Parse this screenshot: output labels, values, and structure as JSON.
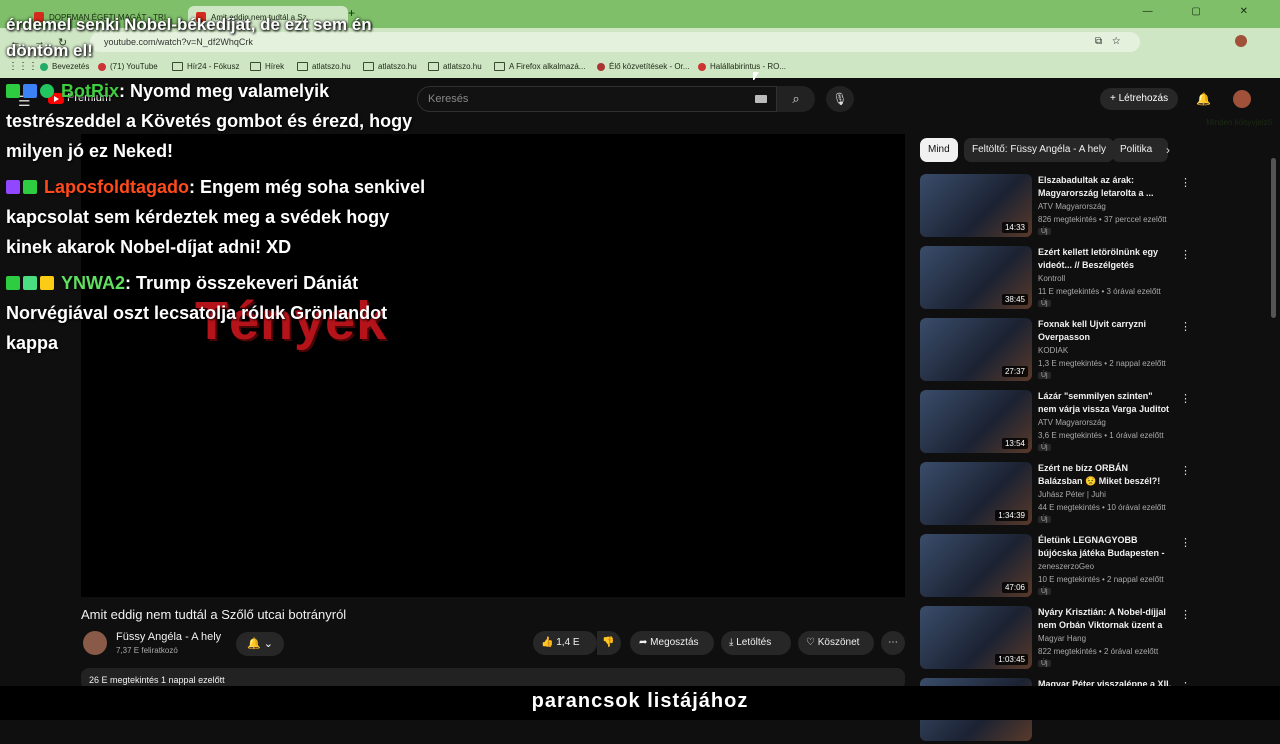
{
  "browser": {
    "tabs": [
      {
        "label": "DOPEMAN ÉGETI MAGÁT - TRI..."
      },
      {
        "label": "Amit eddig nem tudtál a Sz..."
      }
    ],
    "new_tab": "+",
    "url": "youtube.com/watch?v=N_df2WhqCrk",
    "bookmarks": [
      {
        "label": "Bevezetés"
      },
      {
        "label": "(71) YouTube"
      },
      {
        "label": "Hír24 - Fókusz"
      },
      {
        "label": "Hírek"
      },
      {
        "label": "atlatszo.hu"
      },
      {
        "label": "atlatszo.hu"
      },
      {
        "label": "atlatszo.hu"
      },
      {
        "label": "A Firefox alkalmazá..."
      },
      {
        "label": "Élő közvetítések - Or..."
      },
      {
        "label": "Halállabirintus - RO..."
      }
    ],
    "all_bookmarks": "Minden könyvjelző"
  },
  "youtube": {
    "premium_label": "Premium",
    "search_placeholder": "Keresés",
    "create_label": "Létrehozás",
    "video": {
      "overlay_logo": "Tények",
      "title": "Amit eddig nem tudtál a Szőlő utcai botrányról",
      "channel": "Füssy Angéla - A hely",
      "subscribers": "7,37 E feliratkozó",
      "likes": "1,4 E",
      "share": "Megosztás",
      "download": "Letöltés",
      "thanks": "Köszönet",
      "views_line": "26 E megtekintés  1 nappal ezelőtt"
    },
    "chips": [
      "Mind",
      "Feltöltő: Füssy Angéla - A hely",
      "Politika"
    ],
    "recommendations": [
      {
        "title": "Elszabadultak az árak: Magyarország letarolta a ...",
        "channel": "ATV Magyarország",
        "views": "826 megtekintés • 37 perccel ezelőtt",
        "duration": "14:33",
        "badge": "Új"
      },
      {
        "title": "Ezért kellett letörölnünk egy videót... // Beszélgetés Horvát...",
        "channel": "Kontroll",
        "views": "11 E megtekintés • 3 órával ezelőtt",
        "duration": "38:45",
        "badge": "Új"
      },
      {
        "title": "Foxnak kell Ujvit carryzni Overpasson",
        "channel": "KODIAK",
        "views": "1,3 E megtekintés • 2 nappal ezelőtt",
        "duration": "27:37",
        "badge": "Új"
      },
      {
        "title": "Lázár \"semmilyen szinten\" nem várja vissza Varga Juditot",
        "channel": "ATV Magyarország",
        "views": "3,6 E megtekintés • 1 órával ezelőtt",
        "duration": "13:54",
        "badge": "Új"
      },
      {
        "title": "Ezért ne bízz ORBÁN Balázsban 😟 Miket beszél?!",
        "channel": "Juhász Péter | Juhi",
        "views": "44 E megtekintés • 10 órával ezelőtt",
        "duration": "1:34:39",
        "badge": "Új"
      },
      {
        "title": "Életünk LEGNAGYOBB bújócska játéka Budapesten - ...",
        "channel": "zeneszerzoGeo",
        "views": "10 E megtekintés • 2 nappal ezelőtt",
        "duration": "47:06",
        "badge": "Új"
      },
      {
        "title": "Nyáry Krisztián: A Nobel-díjjal nem Orbán Viktornak üzent a ...",
        "channel": "Magyar Hang",
        "views": "822 megtekintés • 2 órával ezelőtt",
        "duration": "1:03:45",
        "badge": "Új"
      },
      {
        "title": "Magyar Péter visszalépne a XII.",
        "channel": "",
        "views": "",
        "duration": "",
        "badge": ""
      }
    ]
  },
  "overlay": {
    "top_caption": "érdemel senki Nobel-békedíjat, de ezt sem én döntöm el!",
    "chat": [
      {
        "user": "BotRix",
        "user_color": "#3ecf3e",
        "message": ": Nyomd meg valamelyik testrészeddel a Követés gombot és érezd, hogy milyen jó ez Neked!"
      },
      {
        "user": "Laposfoldtagado",
        "user_color": "#ff4a1a",
        "message": ": Engem még soha senkivel kapcsolat sem kérdeztek meg a svédek hogy kinek akarok Nobel-díjat adni! XD"
      },
      {
        "user": "YNWA2",
        "user_color": "#5fe05f",
        "message": ": Trump összekeveri Dániát Norvégiával oszt lecsatolja róluk Grönlandot kappa"
      }
    ],
    "bottom_caption": "parancsok listájához"
  }
}
